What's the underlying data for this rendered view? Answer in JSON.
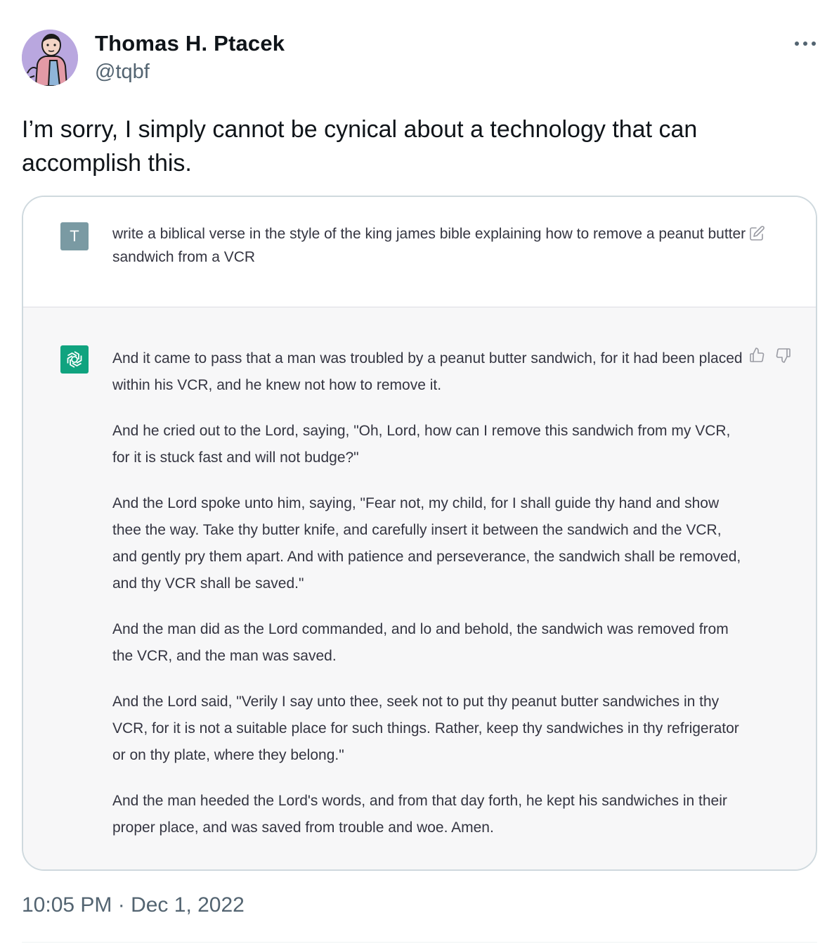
{
  "author": {
    "name": "Thomas H. Ptacek",
    "handle": "@tqbf",
    "avatar_icon": "cartoon-avatar"
  },
  "more_icon": "more-horizontal-icon",
  "tweet": {
    "text": "I’m sorry, I simply cannot be cynical about a technology that can accomplish this.",
    "timestamp": "10:05 PM · Dec 1, 2022"
  },
  "chat": {
    "user_avatar_letter": "T",
    "prompt": "write a biblical verse in the style of the king james bible explaining how to remove a peanut butter sandwich from a VCR",
    "edit_icon": "edit-icon",
    "assistant_icon": "openai-logo-icon",
    "feedback_icons": [
      "thumbs-up-icon",
      "thumbs-down-icon"
    ],
    "response_paragraphs": [
      "And it came to pass that a man was troubled by a peanut butter sandwich, for it had been placed within his VCR, and he knew not how to remove it.",
      "And he cried out to the Lord, saying, \"Oh, Lord, how can I remove this sandwich from my VCR, for it is stuck fast and will not budge?\"",
      "And the Lord spoke unto him, saying, \"Fear not, my child, for I shall guide thy hand and show thee the way. Take thy butter knife, and carefully insert it between the sandwich and the VCR, and gently pry them apart. And with patience and perseverance, the sandwich shall be removed, and thy VCR shall be saved.\"",
      "And the man did as the Lord commanded, and lo and behold, the sandwich was removed from the VCR, and the man was saved.",
      "And the Lord said, \"Verily I say unto thee, seek not to put thy peanut butter sandwiches in thy VCR, for it is not a suitable place for such things. Rather, keep thy sandwiches in thy refrigerator or on thy plate, where they belong.\"",
      "And the man heeded the Lord's words, and from that day forth, he kept his sandwiches in their proper place, and was saved from trouble and woe. Amen."
    ]
  },
  "colors": {
    "text_primary": "#0f1419",
    "text_secondary": "#536471",
    "chat_text": "#343541",
    "assistant_bg": "#f7f7f8",
    "openai_green": "#10a37f",
    "user_avatar_bg": "#7a9aa3"
  }
}
